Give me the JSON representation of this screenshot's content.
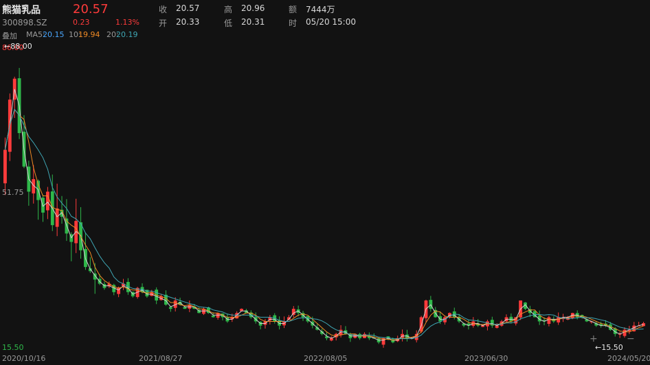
{
  "stock": {
    "name": "熊猫乳品",
    "code": "300898.SZ",
    "price": "20.57",
    "change": "0.23",
    "change_pct": "1.13%"
  },
  "quote": {
    "close_label": "收",
    "close": "20.57",
    "high_label": "高",
    "high": "20.96",
    "amount_label": "额",
    "amount": "7444万",
    "open_label": "开",
    "open": "20.33",
    "low_label": "低",
    "low": "20.31",
    "time_label": "时",
    "time": "05/20 15:00"
  },
  "overlay_label": "叠加",
  "ma": {
    "ma5_label": "MA5:",
    "ma5": "20.15",
    "ma10_label": "10:",
    "ma10": "19.94",
    "ma20_label": "20:",
    "ma20": "20.19"
  },
  "axis": {
    "top": "86.00",
    "mid": "51.75",
    "bottom": "15.50",
    "max_marker": "88.00",
    "min_marker": "15.50"
  },
  "dates": [
    "2020/10/16",
    "2021/08/27",
    "2022/08/05",
    "2023/06/30",
    "2024/05/20"
  ],
  "icons": {
    "zoom_in": "+",
    "zoom_out": "−",
    "arrow": "←"
  },
  "colors": {
    "up": "#ff3b3b",
    "down": "#2fb84a",
    "ma5": "#d0d0d0",
    "ma10": "#f08a24",
    "ma20": "#3fa7b5",
    "accent": "#ff3b3b"
  },
  "chart_data": {
    "type": "candlestick",
    "ylim": [
      15.5,
      86.0
    ],
    "series_note": "weekly candles",
    "closes": [
      62,
      74,
      79,
      66,
      58,
      52,
      55,
      50,
      47,
      52,
      44,
      48,
      46,
      42,
      40,
      45,
      38,
      34,
      33,
      31,
      30,
      29,
      30,
      28,
      29,
      30,
      28,
      27,
      29,
      28,
      27,
      28,
      26,
      27,
      25,
      24,
      26,
      25,
      24,
      25,
      24,
      23,
      24,
      23,
      22,
      23,
      22,
      21,
      22,
      23,
      24,
      23,
      22,
      21,
      20,
      21,
      22,
      21,
      20,
      21,
      22,
      24,
      23,
      22,
      21,
      20,
      19,
      18,
      17,
      17,
      18,
      19,
      18,
      17,
      18,
      17,
      18,
      17,
      17,
      16,
      17,
      17,
      16,
      17,
      18,
      17,
      17,
      18,
      22,
      26,
      24,
      22,
      21,
      22,
      23,
      22,
      21,
      20,
      20,
      21,
      20,
      20,
      21,
      20,
      20,
      21,
      22,
      21,
      22,
      26,
      24,
      23,
      22,
      21,
      21,
      22,
      21,
      22,
      22,
      22,
      23,
      22,
      22,
      21,
      21,
      20,
      20,
      20,
      19,
      18,
      18,
      19,
      19,
      20,
      20,
      20.57
    ]
  }
}
